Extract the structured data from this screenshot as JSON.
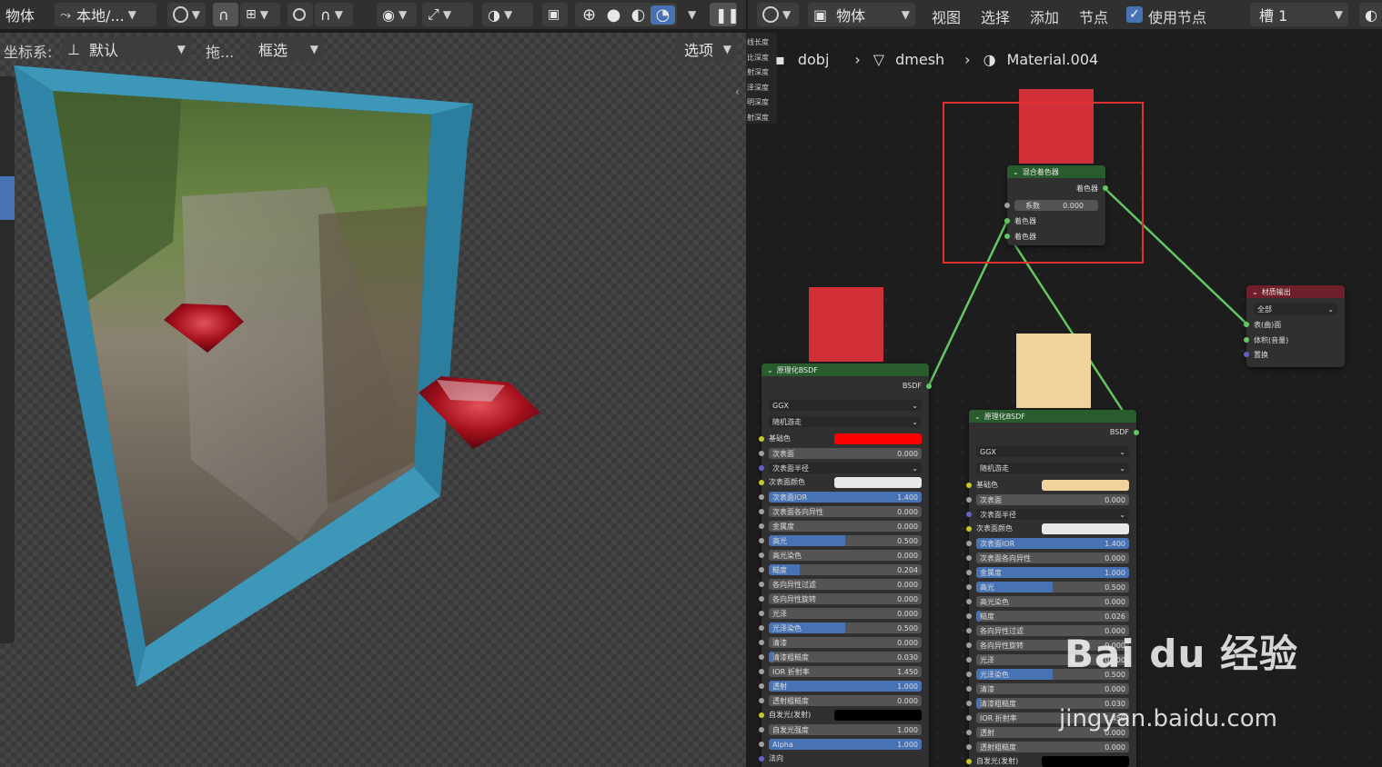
{
  "viewport_header": {
    "mode_label": "物体",
    "transform_orientation": "本地/...",
    "row2": {
      "coord_label": "坐标系:",
      "coord_value": "默认",
      "drag_label": "拖...",
      "select_mode": "框选",
      "options_label": "选项"
    }
  },
  "node_header": {
    "object_label": "物体",
    "view": "视图",
    "select": "选择",
    "add": "添加",
    "node": "节点",
    "use_nodes_label": "使用节点",
    "use_nodes_checked": true,
    "slot": "槽 1"
  },
  "breadcrumb": {
    "object": "dobj",
    "mesh": "dmesh",
    "material": "Material.004"
  },
  "side_sockets": [
    "线长度",
    "比深度",
    "射深度",
    "泽深度",
    "明深度",
    "射深度"
  ],
  "colors": {
    "selection_box": "#e03030",
    "red_swatch": "#d23038",
    "cream_swatch": "#f1d19c",
    "bsdf_red": "#ff0000",
    "link_green": "#63c763"
  },
  "mix_shader": {
    "title": "混合着色器",
    "output": "着色器",
    "fac_label": "系数",
    "fac_value": "0.000",
    "in1": "着色器",
    "in2": "着色器"
  },
  "material_output": {
    "title": "材质输出",
    "target": "全部",
    "surface": "表(曲)面",
    "volume": "体积(音量)",
    "displacement": "置换"
  },
  "bsdf1": {
    "title": "原理化BSDF",
    "output": "BSDF",
    "distribution": "GGX",
    "subsurface_method": "随机游走",
    "base_color_label": "基础色",
    "base_color": "#ff0000",
    "subsurface_color_label": "次表面颜色",
    "subsurface_color": "#e8e8e8",
    "radius_label": "次表面半径",
    "fields": [
      {
        "label": "次表面",
        "value": "0.000",
        "fill": 0
      },
      {
        "label": "次表面IOR",
        "value": "1.400",
        "fill": 1
      },
      {
        "label": "次表面各向异性",
        "value": "0.000",
        "fill": 0
      },
      {
        "label": "金属度",
        "value": "0.000",
        "fill": 0
      },
      {
        "label": "高光",
        "value": "0.500",
        "fill": 0.5
      },
      {
        "label": "高光染色",
        "value": "0.000",
        "fill": 0
      },
      {
        "label": "糙度",
        "value": "0.204",
        "fill": 0.204
      },
      {
        "label": "各向异性过滤",
        "value": "0.000",
        "fill": 0
      },
      {
        "label": "各向异性旋转",
        "value": "0.000",
        "fill": 0
      },
      {
        "label": "光泽",
        "value": "0.000",
        "fill": 0
      },
      {
        "label": "光泽染色",
        "value": "0.500",
        "fill": 0.5
      },
      {
        "label": "清漆",
        "value": "0.000",
        "fill": 0
      },
      {
        "label": "清漆粗糙度",
        "value": "0.030",
        "fill": 0.03
      },
      {
        "label": "IOR 折射率",
        "value": "1.450",
        "fill": 0
      },
      {
        "label": "透射",
        "value": "1.000",
        "fill": 1
      },
      {
        "label": "透射粗糙度",
        "value": "0.000",
        "fill": 0
      }
    ],
    "emission_label": "自发光(发射)",
    "emission_color": "#000000",
    "emission_strength": {
      "label": "自发光强度",
      "value": "1.000",
      "fill": 0
    },
    "alpha": {
      "label": "Alpha",
      "value": "1.000",
      "fill": 1
    },
    "normal_label": "法向"
  },
  "bsdf2": {
    "title": "原理化BSDF",
    "output": "BSDF",
    "distribution": "GGX",
    "subsurface_method": "随机游走",
    "base_color_label": "基础色",
    "base_color": "#f1d19c",
    "subsurface_color_label": "次表面颜色",
    "subsurface_color": "#e8e8e8",
    "radius_label": "次表面半径",
    "fields": [
      {
        "label": "次表面",
        "value": "0.000",
        "fill": 0
      },
      {
        "label": "次表面IOR",
        "value": "1.400",
        "fill": 1
      },
      {
        "label": "次表面各向异性",
        "value": "0.000",
        "fill": 0
      },
      {
        "label": "金属度",
        "value": "1.000",
        "fill": 1
      },
      {
        "label": "高光",
        "value": "0.500",
        "fill": 0.5
      },
      {
        "label": "高光染色",
        "value": "0.000",
        "fill": 0
      },
      {
        "label": "糙度",
        "value": "0.026",
        "fill": 0.026
      },
      {
        "label": "各向异性过滤",
        "value": "0.000",
        "fill": 0
      },
      {
        "label": "各向异性旋转",
        "value": "0.000",
        "fill": 0
      },
      {
        "label": "光泽",
        "value": "0.000",
        "fill": 0
      },
      {
        "label": "光泽染色",
        "value": "0.500",
        "fill": 0.5
      },
      {
        "label": "清漆",
        "value": "0.000",
        "fill": 0
      },
      {
        "label": "清漆粗糙度",
        "value": "0.030",
        "fill": 0.03
      },
      {
        "label": "IOR 折射率",
        "value": "1.450",
        "fill": 0
      },
      {
        "label": "透射",
        "value": "0.000",
        "fill": 0
      },
      {
        "label": "透射粗糙度",
        "value": "0.000",
        "fill": 0
      }
    ],
    "emission_label": "自发光(发射)",
    "emission_color": "#000000"
  },
  "watermark": {
    "brand": "Bai du 经验",
    "url": "jingyan.baidu.com"
  }
}
